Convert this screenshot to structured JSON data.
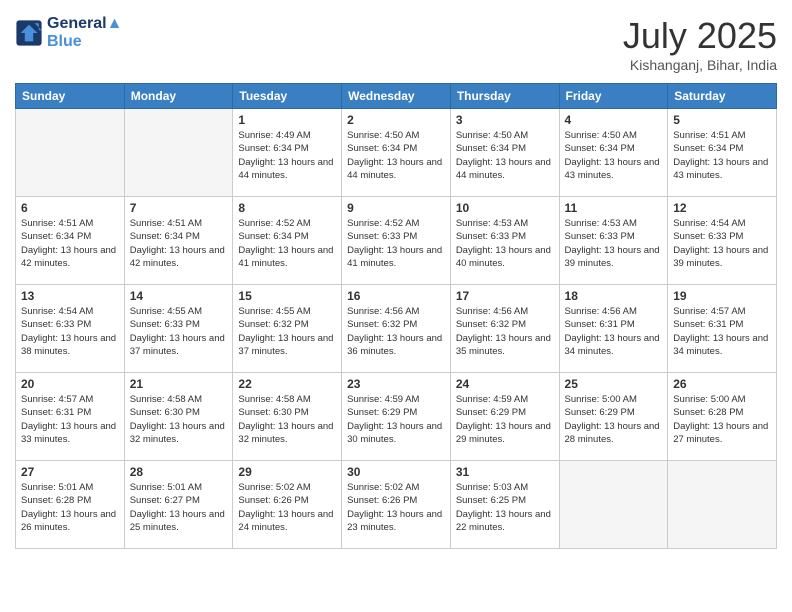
{
  "header": {
    "logo_line1": "General",
    "logo_line2": "Blue",
    "month": "July 2025",
    "location": "Kishanganj, Bihar, India"
  },
  "weekdays": [
    "Sunday",
    "Monday",
    "Tuesday",
    "Wednesday",
    "Thursday",
    "Friday",
    "Saturday"
  ],
  "weeks": [
    [
      {
        "day": "",
        "sunrise": "",
        "sunset": "",
        "daylight": ""
      },
      {
        "day": "",
        "sunrise": "",
        "sunset": "",
        "daylight": ""
      },
      {
        "day": "1",
        "sunrise": "Sunrise: 4:49 AM",
        "sunset": "Sunset: 6:34 PM",
        "daylight": "Daylight: 13 hours and 44 minutes."
      },
      {
        "day": "2",
        "sunrise": "Sunrise: 4:50 AM",
        "sunset": "Sunset: 6:34 PM",
        "daylight": "Daylight: 13 hours and 44 minutes."
      },
      {
        "day": "3",
        "sunrise": "Sunrise: 4:50 AM",
        "sunset": "Sunset: 6:34 PM",
        "daylight": "Daylight: 13 hours and 44 minutes."
      },
      {
        "day": "4",
        "sunrise": "Sunrise: 4:50 AM",
        "sunset": "Sunset: 6:34 PM",
        "daylight": "Daylight: 13 hours and 43 minutes."
      },
      {
        "day": "5",
        "sunrise": "Sunrise: 4:51 AM",
        "sunset": "Sunset: 6:34 PM",
        "daylight": "Daylight: 13 hours and 43 minutes."
      }
    ],
    [
      {
        "day": "6",
        "sunrise": "Sunrise: 4:51 AM",
        "sunset": "Sunset: 6:34 PM",
        "daylight": "Daylight: 13 hours and 42 minutes."
      },
      {
        "day": "7",
        "sunrise": "Sunrise: 4:51 AM",
        "sunset": "Sunset: 6:34 PM",
        "daylight": "Daylight: 13 hours and 42 minutes."
      },
      {
        "day": "8",
        "sunrise": "Sunrise: 4:52 AM",
        "sunset": "Sunset: 6:34 PM",
        "daylight": "Daylight: 13 hours and 41 minutes."
      },
      {
        "day": "9",
        "sunrise": "Sunrise: 4:52 AM",
        "sunset": "Sunset: 6:33 PM",
        "daylight": "Daylight: 13 hours and 41 minutes."
      },
      {
        "day": "10",
        "sunrise": "Sunrise: 4:53 AM",
        "sunset": "Sunset: 6:33 PM",
        "daylight": "Daylight: 13 hours and 40 minutes."
      },
      {
        "day": "11",
        "sunrise": "Sunrise: 4:53 AM",
        "sunset": "Sunset: 6:33 PM",
        "daylight": "Daylight: 13 hours and 39 minutes."
      },
      {
        "day": "12",
        "sunrise": "Sunrise: 4:54 AM",
        "sunset": "Sunset: 6:33 PM",
        "daylight": "Daylight: 13 hours and 39 minutes."
      }
    ],
    [
      {
        "day": "13",
        "sunrise": "Sunrise: 4:54 AM",
        "sunset": "Sunset: 6:33 PM",
        "daylight": "Daylight: 13 hours and 38 minutes."
      },
      {
        "day": "14",
        "sunrise": "Sunrise: 4:55 AM",
        "sunset": "Sunset: 6:33 PM",
        "daylight": "Daylight: 13 hours and 37 minutes."
      },
      {
        "day": "15",
        "sunrise": "Sunrise: 4:55 AM",
        "sunset": "Sunset: 6:32 PM",
        "daylight": "Daylight: 13 hours and 37 minutes."
      },
      {
        "day": "16",
        "sunrise": "Sunrise: 4:56 AM",
        "sunset": "Sunset: 6:32 PM",
        "daylight": "Daylight: 13 hours and 36 minutes."
      },
      {
        "day": "17",
        "sunrise": "Sunrise: 4:56 AM",
        "sunset": "Sunset: 6:32 PM",
        "daylight": "Daylight: 13 hours and 35 minutes."
      },
      {
        "day": "18",
        "sunrise": "Sunrise: 4:56 AM",
        "sunset": "Sunset: 6:31 PM",
        "daylight": "Daylight: 13 hours and 34 minutes."
      },
      {
        "day": "19",
        "sunrise": "Sunrise: 4:57 AM",
        "sunset": "Sunset: 6:31 PM",
        "daylight": "Daylight: 13 hours and 34 minutes."
      }
    ],
    [
      {
        "day": "20",
        "sunrise": "Sunrise: 4:57 AM",
        "sunset": "Sunset: 6:31 PM",
        "daylight": "Daylight: 13 hours and 33 minutes."
      },
      {
        "day": "21",
        "sunrise": "Sunrise: 4:58 AM",
        "sunset": "Sunset: 6:30 PM",
        "daylight": "Daylight: 13 hours and 32 minutes."
      },
      {
        "day": "22",
        "sunrise": "Sunrise: 4:58 AM",
        "sunset": "Sunset: 6:30 PM",
        "daylight": "Daylight: 13 hours and 32 minutes."
      },
      {
        "day": "23",
        "sunrise": "Sunrise: 4:59 AM",
        "sunset": "Sunset: 6:29 PM",
        "daylight": "Daylight: 13 hours and 30 minutes."
      },
      {
        "day": "24",
        "sunrise": "Sunrise: 4:59 AM",
        "sunset": "Sunset: 6:29 PM",
        "daylight": "Daylight: 13 hours and 29 minutes."
      },
      {
        "day": "25",
        "sunrise": "Sunrise: 5:00 AM",
        "sunset": "Sunset: 6:29 PM",
        "daylight": "Daylight: 13 hours and 28 minutes."
      },
      {
        "day": "26",
        "sunrise": "Sunrise: 5:00 AM",
        "sunset": "Sunset: 6:28 PM",
        "daylight": "Daylight: 13 hours and 27 minutes."
      }
    ],
    [
      {
        "day": "27",
        "sunrise": "Sunrise: 5:01 AM",
        "sunset": "Sunset: 6:28 PM",
        "daylight": "Daylight: 13 hours and 26 minutes."
      },
      {
        "day": "28",
        "sunrise": "Sunrise: 5:01 AM",
        "sunset": "Sunset: 6:27 PM",
        "daylight": "Daylight: 13 hours and 25 minutes."
      },
      {
        "day": "29",
        "sunrise": "Sunrise: 5:02 AM",
        "sunset": "Sunset: 6:26 PM",
        "daylight": "Daylight: 13 hours and 24 minutes."
      },
      {
        "day": "30",
        "sunrise": "Sunrise: 5:02 AM",
        "sunset": "Sunset: 6:26 PM",
        "daylight": "Daylight: 13 hours and 23 minutes."
      },
      {
        "day": "31",
        "sunrise": "Sunrise: 5:03 AM",
        "sunset": "Sunset: 6:25 PM",
        "daylight": "Daylight: 13 hours and 22 minutes."
      },
      {
        "day": "",
        "sunrise": "",
        "sunset": "",
        "daylight": ""
      },
      {
        "day": "",
        "sunrise": "",
        "sunset": "",
        "daylight": ""
      }
    ]
  ]
}
